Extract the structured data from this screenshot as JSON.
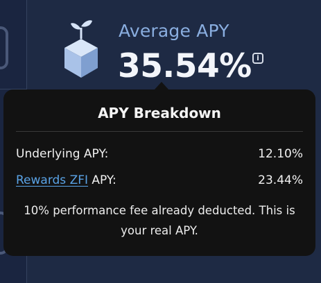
{
  "header": {
    "icon": "sprout-cube-icon",
    "title": "Average APY",
    "value": "35.54%",
    "info_icon": "info-icon"
  },
  "tooltip": {
    "title": "APY Breakdown",
    "rows": [
      {
        "label": "Underlying APY:",
        "value": "12.10%"
      },
      {
        "link_label": "Rewards ZFI",
        "label_suffix": " APY:",
        "value": "23.44%"
      }
    ],
    "note": "10% performance fee already deducted. This is your real APY."
  },
  "colors": {
    "background": "#1e2a44",
    "accent": "#8aaee0",
    "tooltip_bg": "#121212",
    "link": "#5aa3e6"
  }
}
